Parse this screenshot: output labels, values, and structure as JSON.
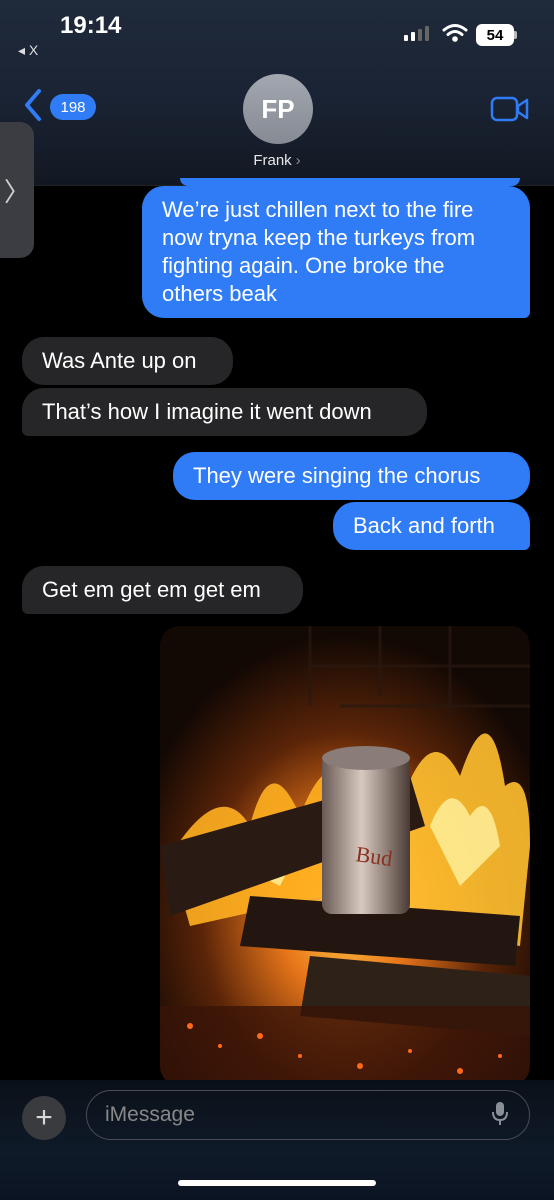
{
  "status": {
    "time": "19:14",
    "back_app": "◂ X",
    "battery": "54"
  },
  "header": {
    "back_count": "198",
    "avatar_initials": "FP",
    "contact_name": "Frank",
    "name_chevron": "›",
    "side_tab_chevron": "〉"
  },
  "messages": [
    {
      "direction": "outgoing",
      "text": "We’re just chillen next to the fire now tryna keep the turkeys from fighting again. One broke the others beak"
    },
    {
      "direction": "incoming",
      "text": "Was Ante up on"
    },
    {
      "direction": "incoming",
      "text": "That’s how I imagine it went down"
    },
    {
      "direction": "outgoing",
      "text": "They were singing the chorus"
    },
    {
      "direction": "outgoing",
      "text": "Back and forth"
    },
    {
      "direction": "incoming",
      "text": "Get em get em get em"
    }
  ],
  "photo": {
    "can_text": "Bud"
  },
  "composer": {
    "plus_label": "+",
    "placeholder": "iMessage"
  },
  "colors": {
    "outgoing": "#2f7cf6",
    "incoming": "#262628",
    "background": "#000000"
  },
  "icons": [
    "back-chevron-icon",
    "video-camera-icon",
    "plus-icon",
    "microphone-icon",
    "wifi-icon",
    "signal-icon",
    "battery-icon"
  ]
}
